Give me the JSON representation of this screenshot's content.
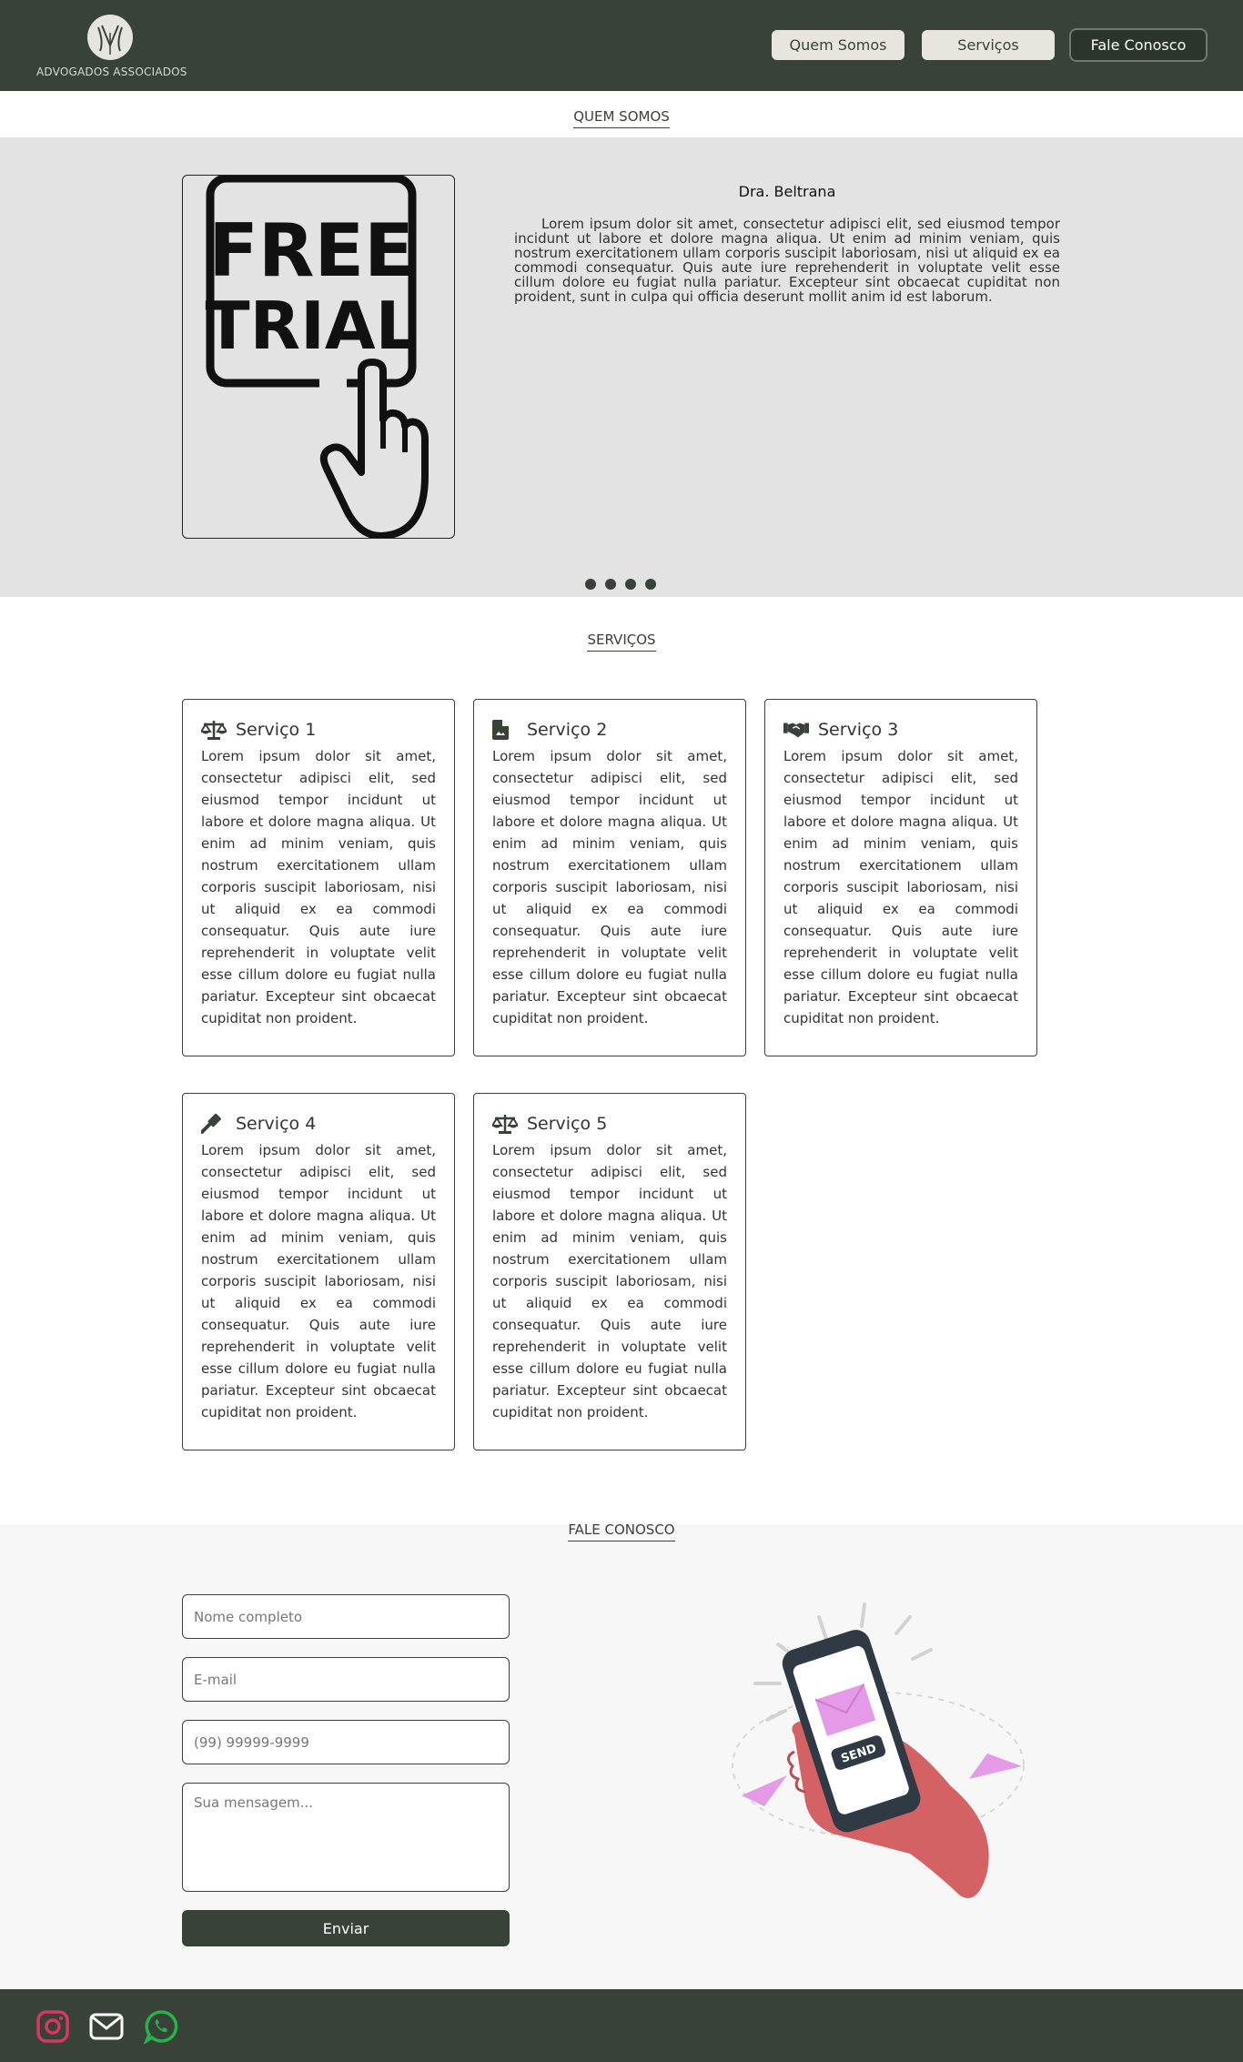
{
  "header": {
    "logo_text": "ADVOGADOS ASSOCIADOS",
    "nav": [
      "Quem Somos",
      "Serviços",
      "Fale Conosco"
    ]
  },
  "about": {
    "section_title": "QUEM SOMOS",
    "name": "Dra. Beltrana",
    "text": "Lorem ipsum dolor sit amet, consectetur adipisci elit, sed eiusmod tempor incidunt ut labore et dolore magna aliqua. Ut enim ad minim veniam, quis nostrum exercitationem ullam corporis suscipit laboriosam, nisi ut aliquid ex ea commodi consequatur. Quis aute iure reprehenderit in voluptate velit esse cillum dolore eu fugiat nulla pariatur. Excepteur sint obcaecat cupiditat non proident, sunt in culpa qui officia deserunt mollit anim id est laborum.",
    "image_text_1": "FREE",
    "image_text_2": "TRIAL",
    "carousel_count": 4
  },
  "services": {
    "section_title": "SERVIÇOS",
    "items": [
      {
        "icon": "scale-icon",
        "title": "Serviço 1",
        "text": "Lorem ipsum dolor sit amet, consectetur adipisci elit, sed eiusmod tempor incidunt ut labore et dolore magna aliqua. Ut enim ad minim veniam, quis nostrum exercitationem ullam corporis suscipit laboriosam, nisi ut aliquid ex ea commodi consequatur. Quis aute iure reprehenderit in voluptate velit esse cillum dolore eu fugiat nulla pariatur. Excepteur sint obcaecat cupiditat non proident."
      },
      {
        "icon": "document-icon",
        "title": "Serviço 2",
        "text": "Lorem ipsum dolor sit amet, consectetur adipisci elit, sed eiusmod tempor incidunt ut labore et dolore magna aliqua. Ut enim ad minim veniam, quis nostrum exercitationem ullam corporis suscipit laboriosam, nisi ut aliquid ex ea commodi consequatur. Quis aute iure reprehenderit in voluptate velit esse cillum dolore eu fugiat nulla pariatur. Excepteur sint obcaecat cupiditat non proident."
      },
      {
        "icon": "handshake-icon",
        "title": "Serviço 3",
        "text": "Lorem ipsum dolor sit amet, consectetur adipisci elit, sed eiusmod tempor incidunt ut labore et dolore magna aliqua. Ut enim ad minim veniam, quis nostrum exercitationem ullam corporis suscipit laboriosam, nisi ut aliquid ex ea commodi consequatur. Quis aute iure reprehenderit in voluptate velit esse cillum dolore eu fugiat nulla pariatur. Excepteur sint obcaecat cupiditat non proident."
      },
      {
        "icon": "gavel-icon",
        "title": "Serviço 4",
        "text": "Lorem ipsum dolor sit amet, consectetur adipisci elit, sed eiusmod tempor incidunt ut labore et dolore magna aliqua. Ut enim ad minim veniam, quis nostrum exercitationem ullam corporis suscipit laboriosam, nisi ut aliquid ex ea commodi consequatur. Quis aute iure reprehenderit in voluptate velit esse cillum dolore eu fugiat nulla pariatur. Excepteur sint obcaecat cupiditat non proident."
      },
      {
        "icon": "scale-icon",
        "title": "Serviço 5",
        "text": "Lorem ipsum dolor sit amet, consectetur adipisci elit, sed eiusmod tempor incidunt ut labore et dolore magna aliqua. Ut enim ad minim veniam, quis nostrum exercitationem ullam corporis suscipit laboriosam, nisi ut aliquid ex ea commodi consequatur. Quis aute iure reprehenderit in voluptate velit esse cillum dolore eu fugiat nulla pariatur. Excepteur sint obcaecat cupiditat non proident."
      }
    ]
  },
  "contact": {
    "section_title": "FALE CONOSCO",
    "name_placeholder": "Nome completo",
    "email_placeholder": "E-mail",
    "phone_placeholder": "(99) 99999-9999",
    "message_placeholder": "Sua mensagem...",
    "submit_label": "Enviar",
    "illustration_text": "SEND"
  },
  "footer": {
    "icons": [
      "instagram-icon",
      "mail-icon",
      "whatsapp-icon"
    ]
  },
  "colors": {
    "primary": "#384239",
    "band": "#e3e3e3",
    "light": "#f7f7f7",
    "instagram": "#d63864",
    "whatsapp": "#25b34a",
    "hand": "#d46264",
    "envelope": "#e49ae6"
  }
}
